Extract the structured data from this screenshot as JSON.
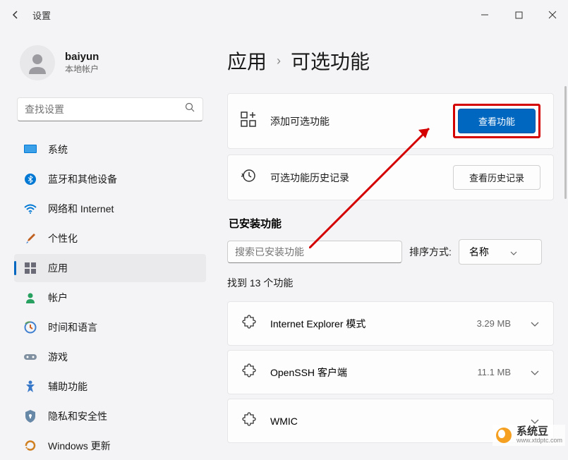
{
  "titlebar": {
    "title": "设置"
  },
  "user": {
    "name": "baiyun",
    "sub": "本地帐户"
  },
  "search": {
    "placeholder": "查找设置"
  },
  "nav": [
    {
      "label": "系统",
      "icon": "system"
    },
    {
      "label": "蓝牙和其他设备",
      "icon": "bluetooth"
    },
    {
      "label": "网络和 Internet",
      "icon": "wifi"
    },
    {
      "label": "个性化",
      "icon": "brush"
    },
    {
      "label": "应用",
      "icon": "apps",
      "active": true
    },
    {
      "label": "帐户",
      "icon": "account"
    },
    {
      "label": "时间和语言",
      "icon": "time"
    },
    {
      "label": "游戏",
      "icon": "game"
    },
    {
      "label": "辅助功能",
      "icon": "accessibility"
    },
    {
      "label": "隐私和安全性",
      "icon": "privacy"
    },
    {
      "label": "Windows 更新",
      "icon": "update"
    }
  ],
  "breadcrumb": {
    "parent": "应用",
    "current": "可选功能"
  },
  "add_card": {
    "label": "添加可选功能",
    "button": "查看功能"
  },
  "history_card": {
    "label": "可选功能历史记录",
    "button": "查看历史记录"
  },
  "installed": {
    "title": "已安装功能",
    "search_placeholder": "搜索已安装功能",
    "sort_label": "排序方式:",
    "sort_value": "名称",
    "found_text": "找到 13 个功能"
  },
  "features": [
    {
      "name": "Internet Explorer 模式",
      "size": "3.29 MB"
    },
    {
      "name": "OpenSSH 客户端",
      "size": "11.1 MB"
    },
    {
      "name": "WMIC",
      "size": ""
    }
  ],
  "watermark": {
    "title": "系统豆",
    "url": "www.xtdptc.com"
  }
}
